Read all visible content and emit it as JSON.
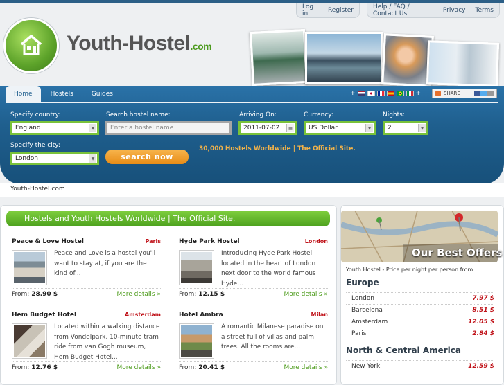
{
  "header": {
    "account_links": [
      "Log in",
      "Register"
    ],
    "help_links": [
      "Help / FAQ / Contact Us",
      "Privacy",
      "Terms"
    ],
    "logo": {
      "name": "Youth-Hostel",
      "suffix": ".com"
    }
  },
  "nav": {
    "tabs": [
      {
        "label": "Home",
        "active": true
      },
      {
        "label": "Hostels",
        "active": false
      },
      {
        "label": "Guides",
        "active": false
      }
    ],
    "share_label": "SHARE"
  },
  "search": {
    "country_label": "Specify country:",
    "country_value": "England",
    "hostel_name_label": "Search hostel name:",
    "hostel_name_placeholder": "Enter a hostel name",
    "arriving_label": "Arriving On:",
    "arriving_value": "2011-07-02",
    "currency_label": "Currency:",
    "currency_value": "US Dollar",
    "nights_label": "Nights:",
    "nights_value": "2",
    "city_label": "Specify the city:",
    "city_value": "London",
    "button_label": "search now",
    "tagline": "30,000 Hostels Worldwide | The Official Site."
  },
  "breadcrumb": "Youth-Hostel.com",
  "main": {
    "heading": "Hostels and Youth Hostels Worldwide | The Official Site.",
    "hostels": [
      {
        "name": "Peace & Love Hostel",
        "city": "Paris",
        "description": "Peace and Love is a hostel you'll want to stay at, if you are the kind of...",
        "price_label": "From:",
        "price": "28.90 $",
        "more": "More details »"
      },
      {
        "name": "Hyde Park Hostel",
        "city": "London",
        "description": "Introducing Hyde Park Hostel located in the heart of London next door to the world famous Hyde...",
        "price_label": "From:",
        "price": "12.15 $",
        "more": "More details »"
      },
      {
        "name": "Hem Budget Hotel",
        "city": "Amsterdam",
        "description": "Located within a walking distance from Vondelpark, 10-minute tram ride from van Gogh museum, Hem Budget Hotel...",
        "price_label": "From:",
        "price": "12.76 $",
        "more": "More details »"
      },
      {
        "name": "Hotel Ambra",
        "city": "Milan",
        "description": "A romantic Milanese paradise on a street full of villas and palm trees. All the rooms are...",
        "price_label": "From:",
        "price": "20.41 $",
        "more": "More details »"
      }
    ]
  },
  "sidebar": {
    "title": "Our Best Offers",
    "subtitle": "Youth Hostel - Price per night per person from:",
    "regions": [
      {
        "name": "Europe",
        "offers": [
          {
            "city": "London",
            "price": "7.97 $"
          },
          {
            "city": "Barcelona",
            "price": "8.51 $"
          },
          {
            "city": "Amsterdam",
            "price": "12.05 $"
          },
          {
            "city": "Paris",
            "price": "2.84 $"
          }
        ]
      },
      {
        "name": "North & Central America",
        "offers": [
          {
            "city": "New York",
            "price": "12.59 $"
          }
        ]
      }
    ]
  },
  "colors": {
    "brand_blue": "#1f5f8e",
    "brand_green": "#5da32a",
    "accent_orange": "#e88c16",
    "price_red": "#c0131a"
  }
}
